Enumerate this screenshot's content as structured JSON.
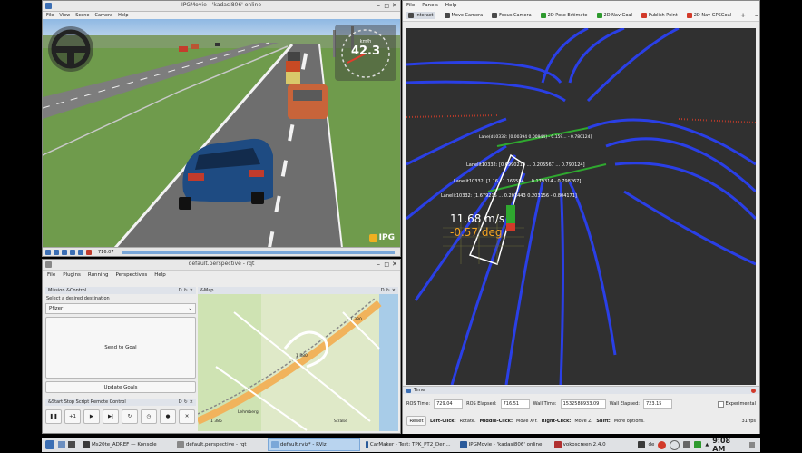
{
  "ipg": {
    "title": "IPGMovie - 'kadasi806' online",
    "menu": [
      "File",
      "View",
      "Scene",
      "Camera",
      "Help"
    ],
    "speed_unit": "km/h",
    "speed_value": "42.3",
    "logo": "IPG",
    "time_readout": "716.07"
  },
  "rviz": {
    "menu": [
      "File",
      "Panels",
      "Help"
    ],
    "tools": [
      {
        "label": "Interact",
        "color": "#4a4a4a"
      },
      {
        "label": "Move Camera",
        "color": "#4a4a4a"
      },
      {
        "label": "Focus Camera",
        "color": "#4a4a4a"
      },
      {
        "label": "2D Pose Estimate",
        "color": "#2e9a2e"
      },
      {
        "label": "2D Nav Goal",
        "color": "#2e9a2e"
      },
      {
        "label": "Publish Point",
        "color": "#d23a2a"
      },
      {
        "label": "2D Nav GPSGoal",
        "color": "#d23a2a"
      }
    ],
    "annotations": {
      "lane1": "Lane(d10332: [0.00394 0.00944] - 0.159... - 0.780124]",
      "lane2": "Lanelit10332: [0.6990214 ... 0.205567 ... 0.790124]",
      "lane3": "Lanelit10332: [1.16...1.166584 ... 0.179314 - 0.798267]",
      "lane4": "Lanelit10332: [1.679215 ... 0.201443 0.203156 - 0.804171]",
      "speed": "11.68 m/s",
      "heading": "-0.57 deg"
    },
    "time_panel": {
      "header": "Time",
      "ros_time_label": "ROS Time:",
      "ros_time": "729.04",
      "ros_elapsed_label": "ROS Elapsed:",
      "ros_elapsed": "716.51",
      "wall_time_label": "Wall Time:",
      "wall_time": "1532588933.09",
      "wall_elapsed_label": "Wall Elapsed:",
      "wall_elapsed": "723.15",
      "experimental": "Experimental",
      "reset": "Reset",
      "hint_left": "Left-Click:",
      "hint_left_text": "Rotate.",
      "hint_mid": "Middle-Click:",
      "hint_mid_text": "Move X/Y.",
      "hint_right": "Right-Click:",
      "hint_right_text": "Move Z.",
      "hint_shift": "Shift:",
      "hint_shift_text": "More options.",
      "fps": "31 fps"
    }
  },
  "rqt": {
    "title": "default.perspective - rqt",
    "menu": [
      "File",
      "Plugins",
      "Running",
      "Perspectives",
      "Help"
    ],
    "mission_header": "Mission &Control",
    "select_label": "Select a desired destination",
    "destination": "Pfizer",
    "send_goal": "Send to Goal",
    "update_goals": "Update Goals",
    "script_header": "&Start Stop Script Remote Control",
    "map_header": "&Map",
    "map_labels": [
      "1 380",
      "1 380",
      "1 385",
      "Lehmberg",
      "Straße"
    ]
  },
  "taskbar": {
    "tasks": [
      {
        "label": "Ms20te_ADREF — Konsole",
        "color": "#3a3a3a",
        "active": false
      },
      {
        "label": "default.perspective - rqt",
        "color": "#888888",
        "active": false
      },
      {
        "label": "default.rviz* - RViz",
        "color": "#7aa7d8",
        "active": true
      },
      {
        "label": "CarMaker - Test: TPK_PT2_Deri...",
        "color": "#2a5a9a",
        "active": false
      },
      {
        "label": "IPGMovie - 'kadasi806' online",
        "color": "#2a5a9a",
        "active": false
      },
      {
        "label": "vokoscreen 2.4.0",
        "color": "#b03030",
        "active": false
      }
    ],
    "lang": "de",
    "clock": "9:08 AM"
  }
}
